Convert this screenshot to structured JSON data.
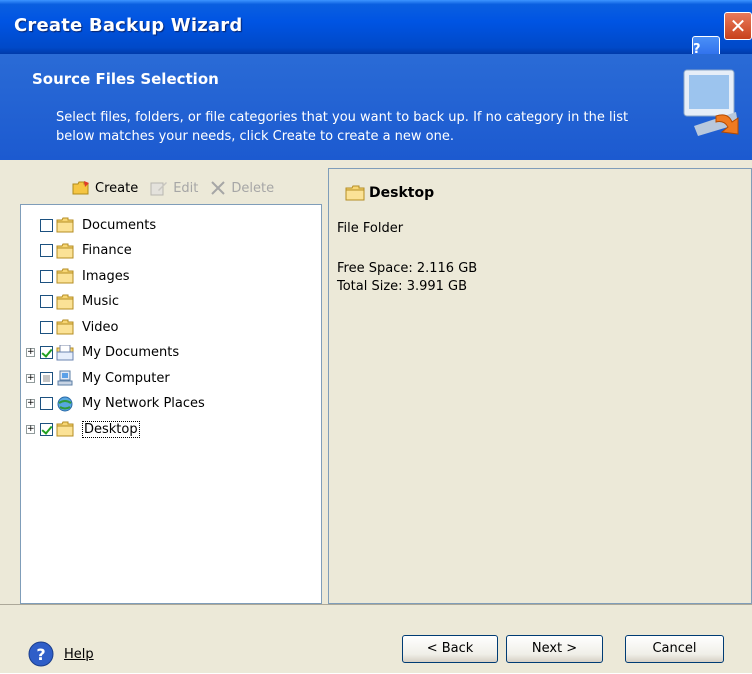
{
  "window": {
    "title": "Create Backup Wizard",
    "help_glyph": "?",
    "close_glyph": "✕"
  },
  "header": {
    "title": "Source Files Selection",
    "description": "Select files, folders, or file categories that you want to back up. If no category in the list below matches your needs, click Create to create a new one."
  },
  "toolbar": {
    "create": "Create",
    "edit": "Edit",
    "delete": "Delete"
  },
  "tree": {
    "items": [
      {
        "label": "Documents",
        "icon": "folder-icon",
        "state": "unchecked",
        "expandable": false
      },
      {
        "label": "Finance",
        "icon": "folder-icon",
        "state": "unchecked",
        "expandable": false
      },
      {
        "label": "Images",
        "icon": "folder-icon",
        "state": "unchecked",
        "expandable": false
      },
      {
        "label": "Music",
        "icon": "folder-icon",
        "state": "unchecked",
        "expandable": false
      },
      {
        "label": "Video",
        "icon": "folder-icon",
        "state": "unchecked",
        "expandable": false
      },
      {
        "label": "My Documents",
        "icon": "my-documents-icon",
        "state": "checked",
        "expandable": true
      },
      {
        "label": "My Computer",
        "icon": "my-computer-icon",
        "state": "partial",
        "expandable": true
      },
      {
        "label": "My Network Places",
        "icon": "network-places-icon",
        "state": "unchecked",
        "expandable": true
      },
      {
        "label": "Desktop",
        "icon": "folder-icon",
        "state": "checked",
        "expandable": true,
        "selected": true
      }
    ]
  },
  "details": {
    "title": "Desktop",
    "type": "File Folder",
    "free_space": "Free Space: 2.116 GB",
    "total_size": "Total Size: 3.991 GB"
  },
  "footer": {
    "help": "Help",
    "back": "< Back",
    "next": "Next >",
    "cancel": "Cancel"
  }
}
